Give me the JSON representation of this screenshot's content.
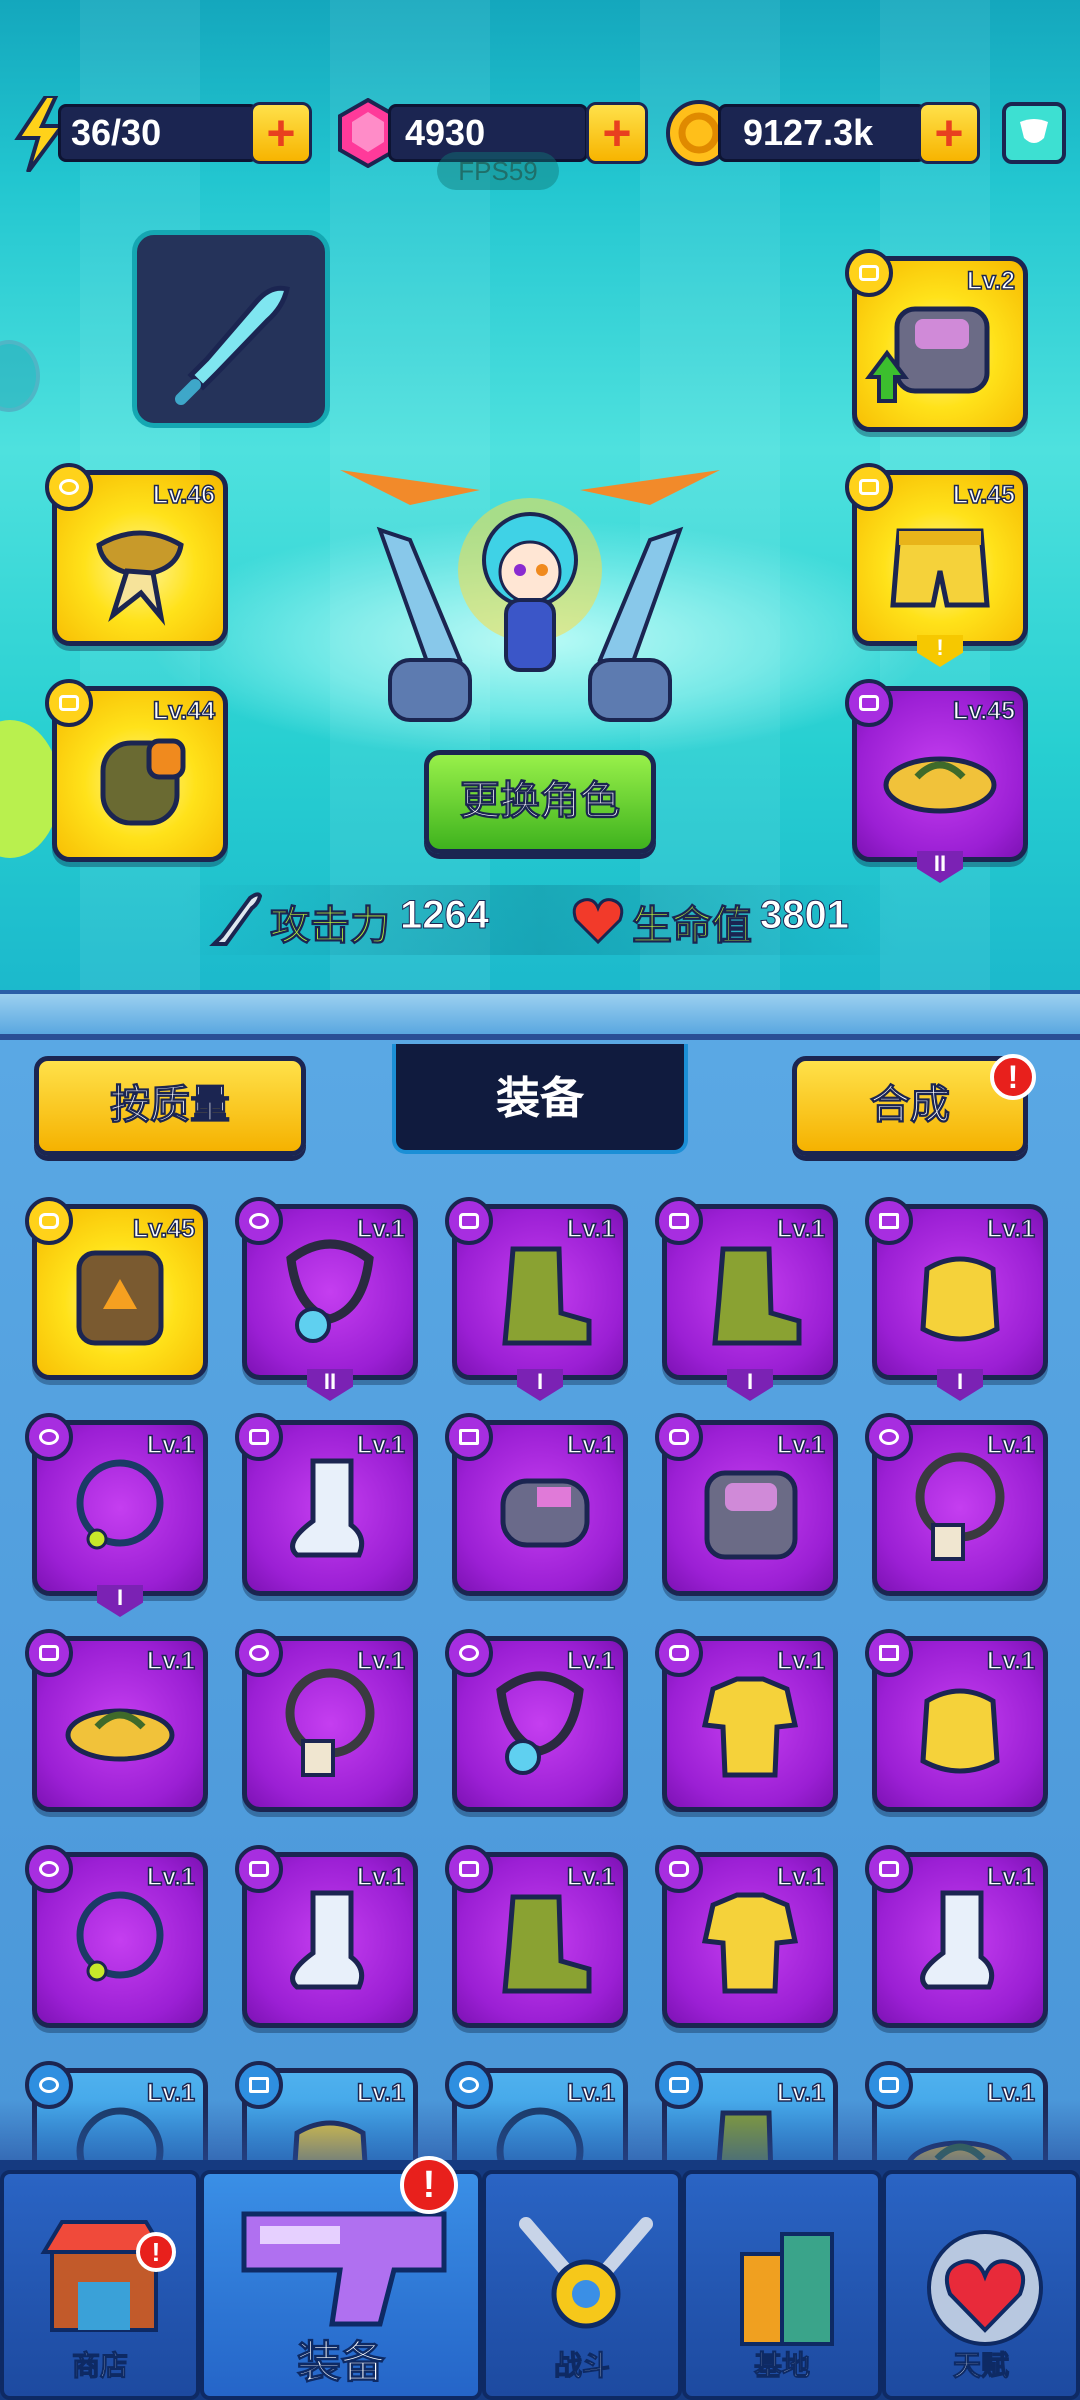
{
  "resources": {
    "energy": {
      "value": "36/30",
      "icon": "lightning-icon"
    },
    "gems": {
      "value": "4930",
      "icon": "gem-icon"
    },
    "coins": {
      "value": "9127.3k",
      "icon": "coin-icon"
    }
  },
  "fps": "FPS59",
  "character": {
    "change_label": "更换角色",
    "attack_label": "攻击力",
    "attack_value": "1264",
    "hp_label": "生命值",
    "hp_value": "3801"
  },
  "equipped": {
    "left": [
      {
        "level": "Lv.46",
        "item": "scarf"
      },
      {
        "level": "Lv.44",
        "item": "glove"
      }
    ],
    "right": [
      {
        "level": "Lv.2",
        "item": "armor"
      },
      {
        "level": "Lv.45",
        "item": "shorts"
      },
      {
        "level": "Lv.45",
        "item": "sandal"
      }
    ]
  },
  "panel": {
    "sort_label": "按质量",
    "title": "装备",
    "merge_label": "合成",
    "merge_badge": "!"
  },
  "inventory": [
    {
      "level": "Lv.45",
      "item": "vest"
    },
    {
      "level": "Lv.1",
      "item": "pendant"
    },
    {
      "level": "Lv.1",
      "item": "boot"
    },
    {
      "level": "Lv.1",
      "item": "boot"
    },
    {
      "level": "Lv.1",
      "item": "glove"
    },
    {
      "level": "Lv.1",
      "item": "necklace"
    },
    {
      "level": "Lv.1",
      "item": "sock"
    },
    {
      "level": "Lv.1",
      "item": "gauntlet"
    },
    {
      "level": "Lv.1",
      "item": "armor"
    },
    {
      "level": "Lv.1",
      "item": "tag-necklace"
    },
    {
      "level": "Lv.1",
      "item": "sandal"
    },
    {
      "level": "Lv.1",
      "item": "tag-necklace"
    },
    {
      "level": "Lv.1",
      "item": "pendant"
    },
    {
      "level": "Lv.1",
      "item": "shirt"
    },
    {
      "level": "Lv.1",
      "item": "glove"
    },
    {
      "level": "Lv.1",
      "item": "necklace"
    },
    {
      "level": "Lv.1",
      "item": "sock"
    },
    {
      "level": "Lv.1",
      "item": "boot"
    },
    {
      "level": "Lv.1",
      "item": "shirt"
    },
    {
      "level": "Lv.1",
      "item": "sock"
    },
    {
      "level": "Lv.1",
      "item": "necklace"
    },
    {
      "level": "Lv.1",
      "item": "glove"
    },
    {
      "level": "Lv.1",
      "item": "necklace"
    },
    {
      "level": "Lv.1",
      "item": "boot"
    },
    {
      "level": "Lv.1",
      "item": "sandal"
    }
  ],
  "nav": [
    {
      "label": "商店",
      "icon": "shop-icon",
      "badge": "!"
    },
    {
      "label": "装备",
      "icon": "equipment-gun-icon",
      "badge": "!"
    },
    {
      "label": "战斗",
      "icon": "battle-swords-icon"
    },
    {
      "label": "基地",
      "icon": "base-building-icon"
    },
    {
      "label": "天赋",
      "icon": "talent-heart-icon"
    }
  ],
  "colors": {
    "gold_slot": "#ffe21a",
    "purple_slot": "#9b1fd4",
    "blue_slot": "#2f8fe0",
    "navy_outline": "#1b2551",
    "stat_green": "#b8f33a"
  }
}
